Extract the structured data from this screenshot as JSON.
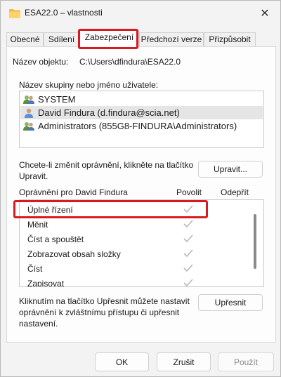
{
  "window": {
    "title": "ESA22.0 – vlastnosti",
    "close_symbol": "✕"
  },
  "tabs": [
    {
      "label": "Obecné"
    },
    {
      "label": "Sdílení"
    },
    {
      "label": "Zabezpečení"
    },
    {
      "label": "Předchozí verze"
    },
    {
      "label": "Přizpůsobit"
    }
  ],
  "security": {
    "object_label": "Název objektu:",
    "object_value": "C:\\Users\\dfindura\\ESA22.0",
    "group_label": "Název skupiny nebo jméno uživatele:",
    "groups": [
      {
        "name": "SYSTEM",
        "icon": "user-group-icon"
      },
      {
        "name": "David Findura (d.findura@scia.net)",
        "icon": "user-icon"
      },
      {
        "name": "Administrators (855G8-FINDURA\\Administrators)",
        "icon": "user-group-icon"
      }
    ],
    "change_text": "Chcete-li změnit oprávnění, klikněte na tlačítko Upravit.",
    "edit_button": "Upravit...",
    "permissions_header": "Oprávnění pro David Findura",
    "allow_header": "Povolit",
    "deny_header": "Odepřít",
    "permissions": [
      {
        "name": "Úplné řízení",
        "allow": true,
        "deny": false
      },
      {
        "name": "Měnit",
        "allow": true,
        "deny": false
      },
      {
        "name": "Číst a spouštět",
        "allow": true,
        "deny": false
      },
      {
        "name": "Zobrazovat obsah složky",
        "allow": true,
        "deny": false
      },
      {
        "name": "Číst",
        "allow": true,
        "deny": false
      },
      {
        "name": "Zapisovat",
        "allow": true,
        "deny": false
      }
    ],
    "advanced_text": "Kliknutím na tlačítko Upřesnit můžete nastavit oprávnění k zvláštnímu přístupu či upřesnit nastavení.",
    "advanced_button": "Upřesnit"
  },
  "footer": {
    "ok": "OK",
    "cancel": "Zrušit",
    "apply": "Použít"
  },
  "colors": {
    "highlight": "#d81b21",
    "selected_row": "#e5e5e5",
    "check": "#b8b8b8"
  }
}
